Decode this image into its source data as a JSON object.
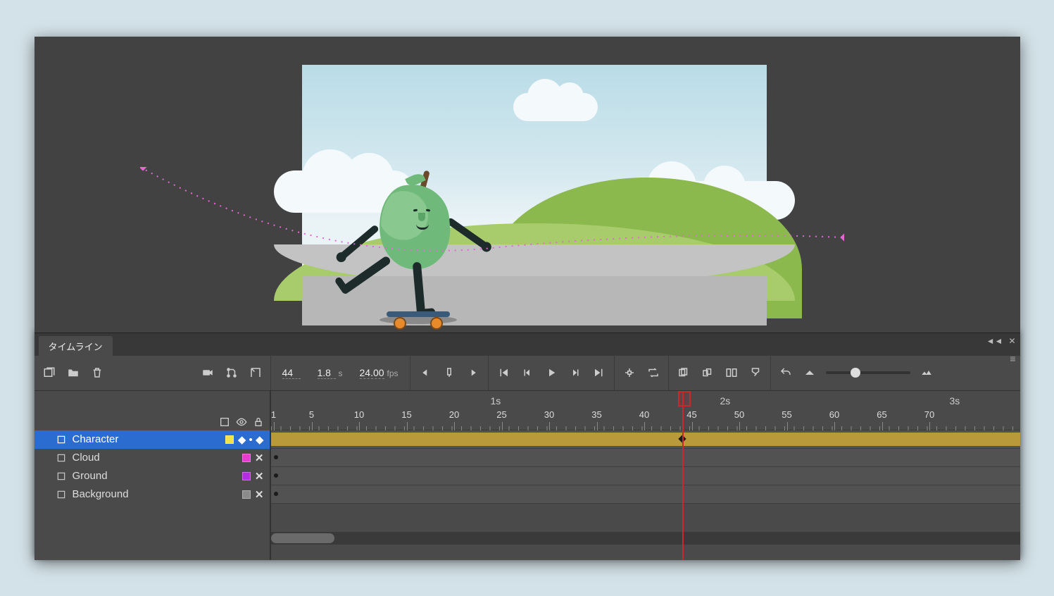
{
  "panel": {
    "title": "タイムライン"
  },
  "playback": {
    "current_frame": "44",
    "elapsed_time": "1.8",
    "elapsed_unit": "s",
    "fps": "24.00",
    "fps_unit": "fps"
  },
  "ruler": {
    "seconds": [
      "1s",
      "2s",
      "3s"
    ],
    "frames": [
      "1",
      "5",
      "10",
      "15",
      "20",
      "25",
      "30",
      "35",
      "40",
      "45",
      "50",
      "55",
      "60",
      "65",
      "70"
    ]
  },
  "layers": [
    {
      "name": "Character",
      "color": "#f2e24a",
      "marker": "diamond",
      "selected": true
    },
    {
      "name": "Cloud",
      "color": "#e83ad1",
      "marker": "x",
      "selected": false
    },
    {
      "name": "Ground",
      "color": "#b22ee0",
      "marker": "x",
      "selected": false
    },
    {
      "name": "Background",
      "color": "#8a8a8a",
      "marker": "x",
      "selected": false
    }
  ],
  "colors": {
    "tween": "#b89a3a",
    "playhead": "#c62a2a",
    "selected_row": "#2b6cd1"
  }
}
